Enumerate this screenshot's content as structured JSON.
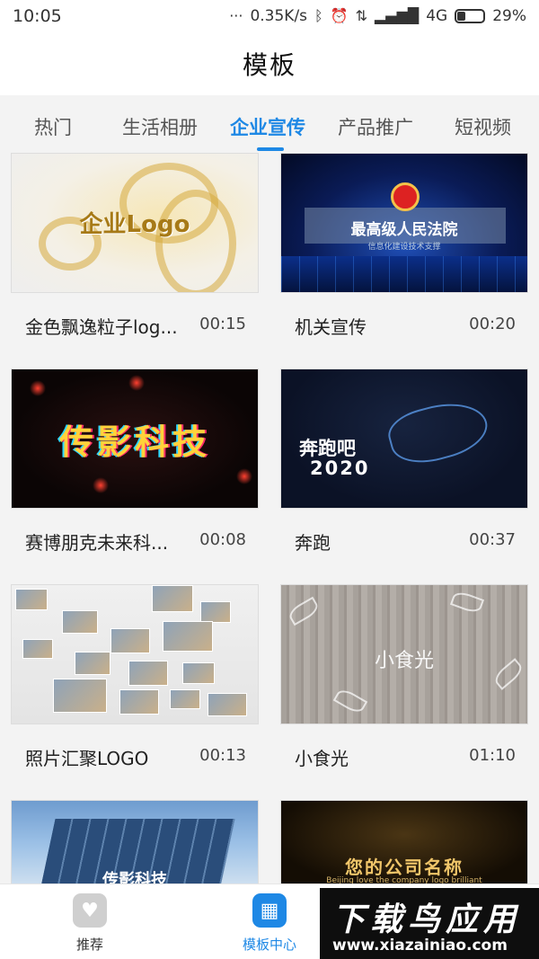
{
  "status_bar": {
    "time": "10:05",
    "network_speed": "0.35K/s",
    "network_type": "4G",
    "battery": "29%",
    "battery_level": 0.29,
    "icons": [
      "dots-icon",
      "bluetooth-icon",
      "alarm-icon",
      "data-arrows-icon",
      "signal-icon",
      "battery-icon"
    ]
  },
  "header": {
    "title": "模板"
  },
  "tabs": [
    {
      "label": "热门"
    },
    {
      "label": "生活相册"
    },
    {
      "label": "企业宣传",
      "active": true
    },
    {
      "label": "产品推广"
    },
    {
      "label": "短视频"
    }
  ],
  "templates": [
    {
      "title": "金色飘逸粒子log...",
      "duration": "00:15",
      "thumb_text": "企业Logo"
    },
    {
      "title": "机关宣传",
      "duration": "00:20",
      "thumb_text": "最高级人民法院",
      "thumb_sub": "信息化建设技术支撑"
    },
    {
      "title": "赛博朋克未来科...",
      "duration": "00:08",
      "thumb_text": "传影科技"
    },
    {
      "title": "奔跑",
      "duration": "00:37",
      "thumb_text": "奔跑吧",
      "thumb_text2": "2020"
    },
    {
      "title": "照片汇聚LOGO",
      "duration": "00:13"
    },
    {
      "title": "小食光",
      "duration": "01:10",
      "thumb_text": "小食光"
    },
    {
      "thumb_text": "传影科技"
    },
    {
      "thumb_text": "您的公司名称",
      "thumb_sub": "Beijing love the company logo brilliant"
    }
  ],
  "bottom_nav": [
    {
      "label": "推荐",
      "icon": "heart-icon"
    },
    {
      "label": "模板中心",
      "icon": "template-icon",
      "active": true
    }
  ],
  "watermark": {
    "main": "下载鸟应用",
    "url": "www.xiazainiao.com"
  },
  "colors": {
    "accent": "#1e88e5",
    "background": "#f3f3f3"
  }
}
